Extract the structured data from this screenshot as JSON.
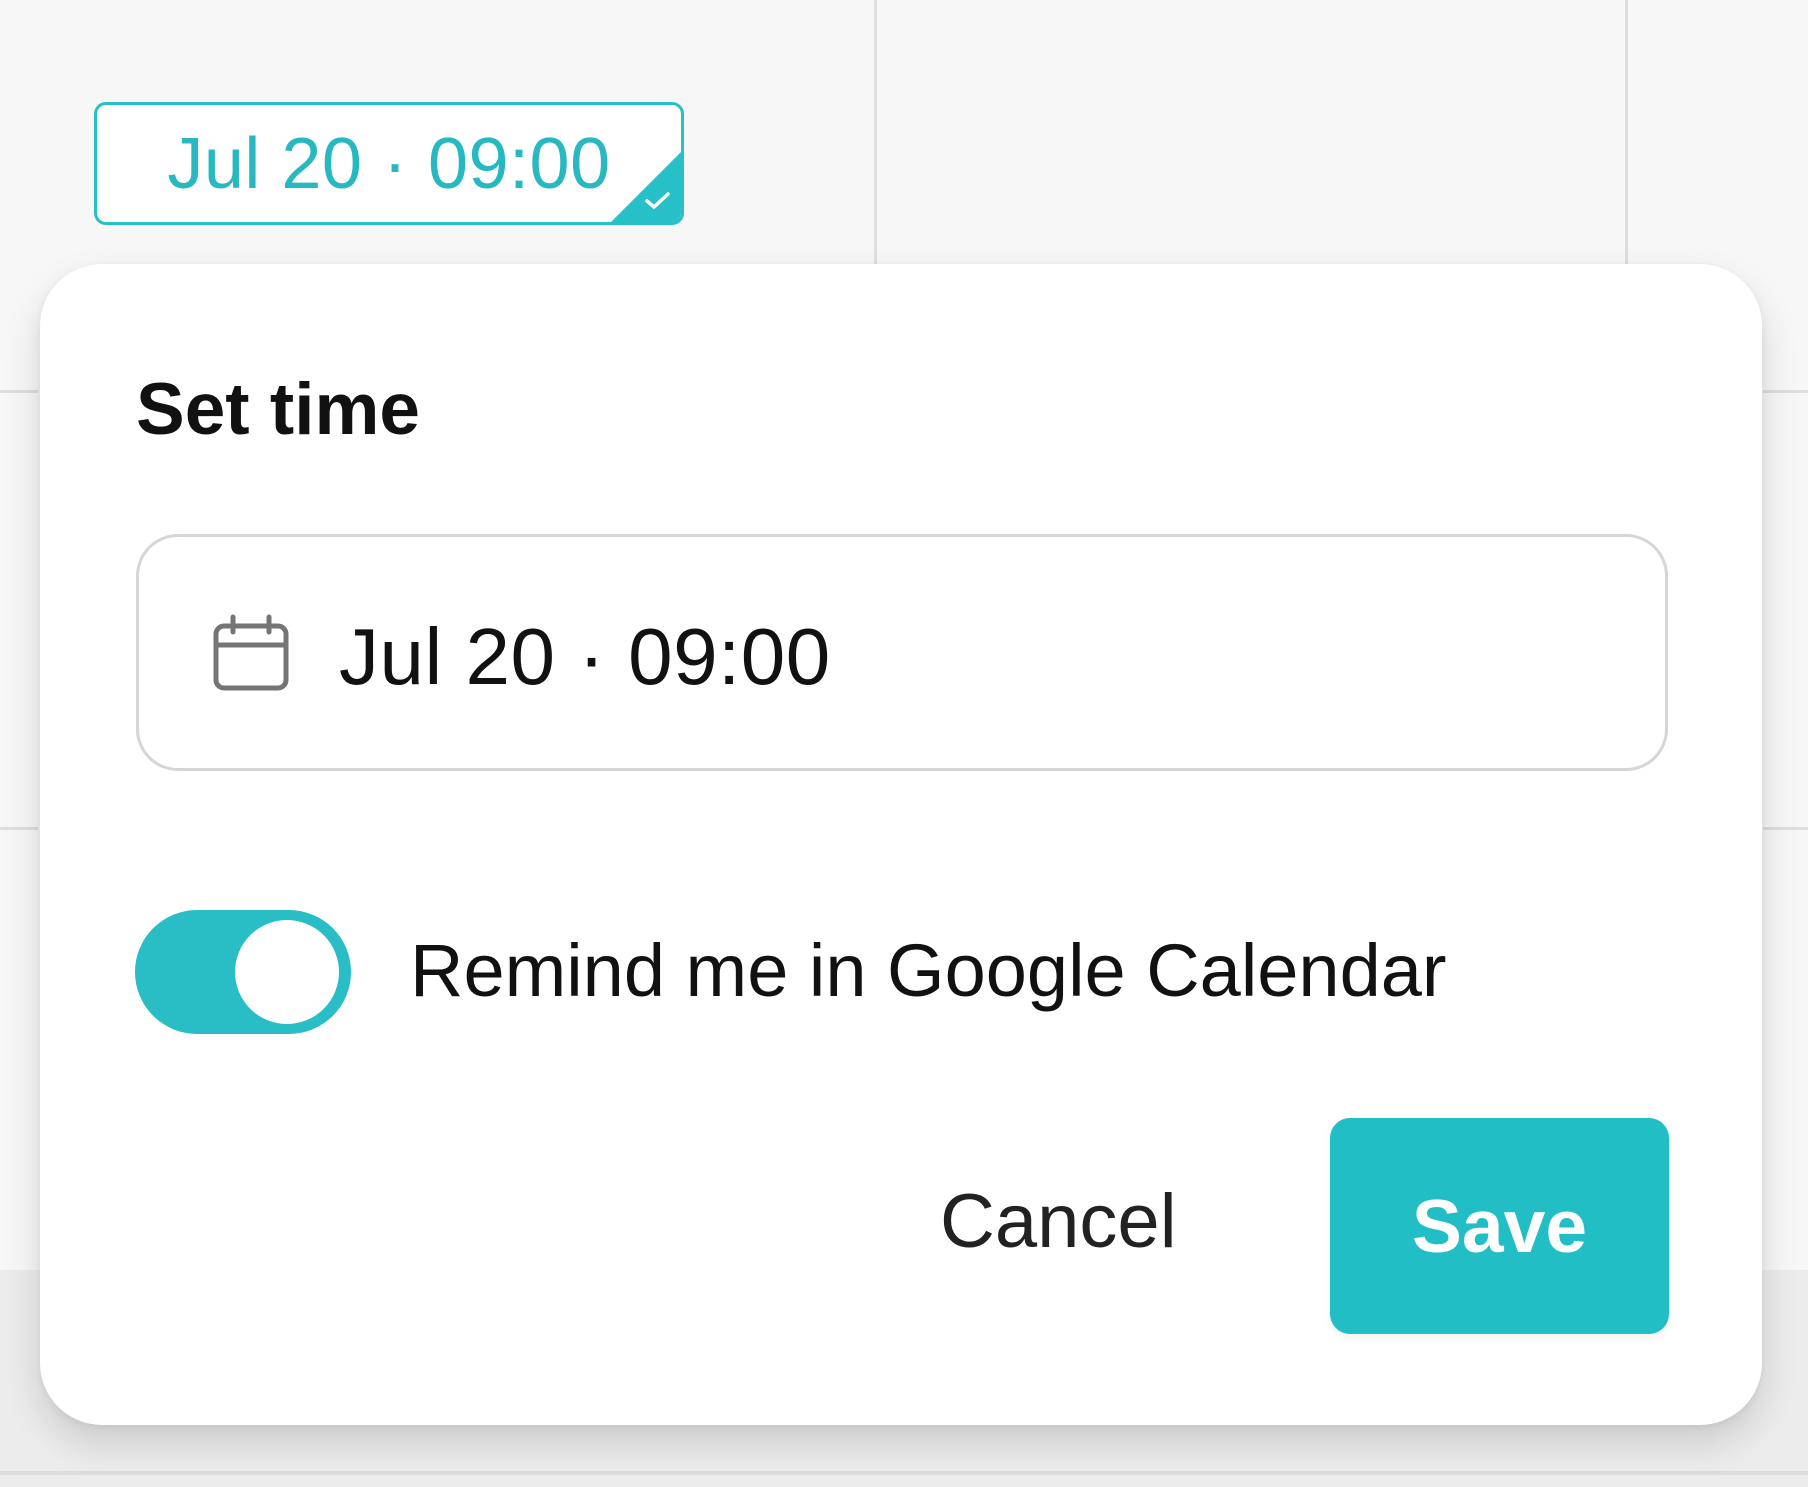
{
  "top_chip": {
    "text": "Jul 20 · 09:00",
    "accent_color": "#28C0C8",
    "status_icon": "check-icon"
  },
  "dialog": {
    "title": "Set time",
    "field": {
      "icon": "calendar-icon",
      "value": "Jul 20 · 09:00"
    },
    "toggle": {
      "label": "Remind me in Google Calendar",
      "checked": true,
      "color": "#29BDC6"
    },
    "buttons": {
      "cancel": "Cancel",
      "save": "Save",
      "save_color": "#22BEC6"
    }
  }
}
